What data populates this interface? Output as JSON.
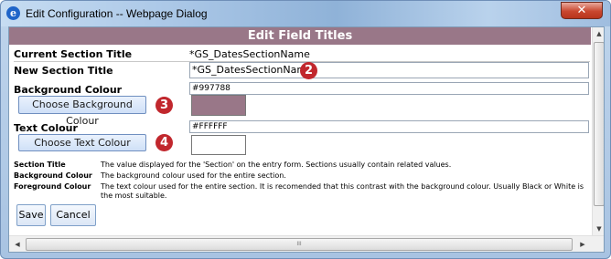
{
  "window": {
    "title": "Edit Configuration -- Webpage Dialog",
    "close_glyph": "✕"
  },
  "page": {
    "header": "Edit Field Titles"
  },
  "form": {
    "current_title_label": "Current Section Title",
    "current_title_value": "*GS_DatesSectionName",
    "new_title_label": "New Section Title",
    "new_title_value": "*GS_DatesSectionName",
    "bg_colour_label": "Background Colour",
    "bg_colour_value": "#997788",
    "choose_bg_button": "Choose Background Colour",
    "text_colour_label": "Text Colour",
    "text_colour_value": "#FFFFFF",
    "choose_text_button": "Choose Text Colour"
  },
  "badges": {
    "two": "2",
    "three": "3",
    "four": "4"
  },
  "help": [
    {
      "term": "Section Title",
      "desc": "The value displayed for the 'Section' on the entry form. Sections usually contain related values."
    },
    {
      "term": "Background Colour",
      "desc": "The background colour used for the entire section."
    },
    {
      "term": "Foreground Colour",
      "desc": "The text colour used for the entire section. It is recomended that this contrast with the background colour. Usually Black or White is the most suitable."
    }
  ],
  "actions": {
    "save": "Save",
    "cancel": "Cancel"
  },
  "colors": {
    "section_background": "#997788",
    "section_text": "#FFFFFF",
    "badge": "#c1272d"
  },
  "icons": [
    "ie-app-icon",
    "close-icon",
    "scroll-up-icon",
    "scroll-down-icon",
    "scroll-left-icon",
    "scroll-right-icon"
  ]
}
